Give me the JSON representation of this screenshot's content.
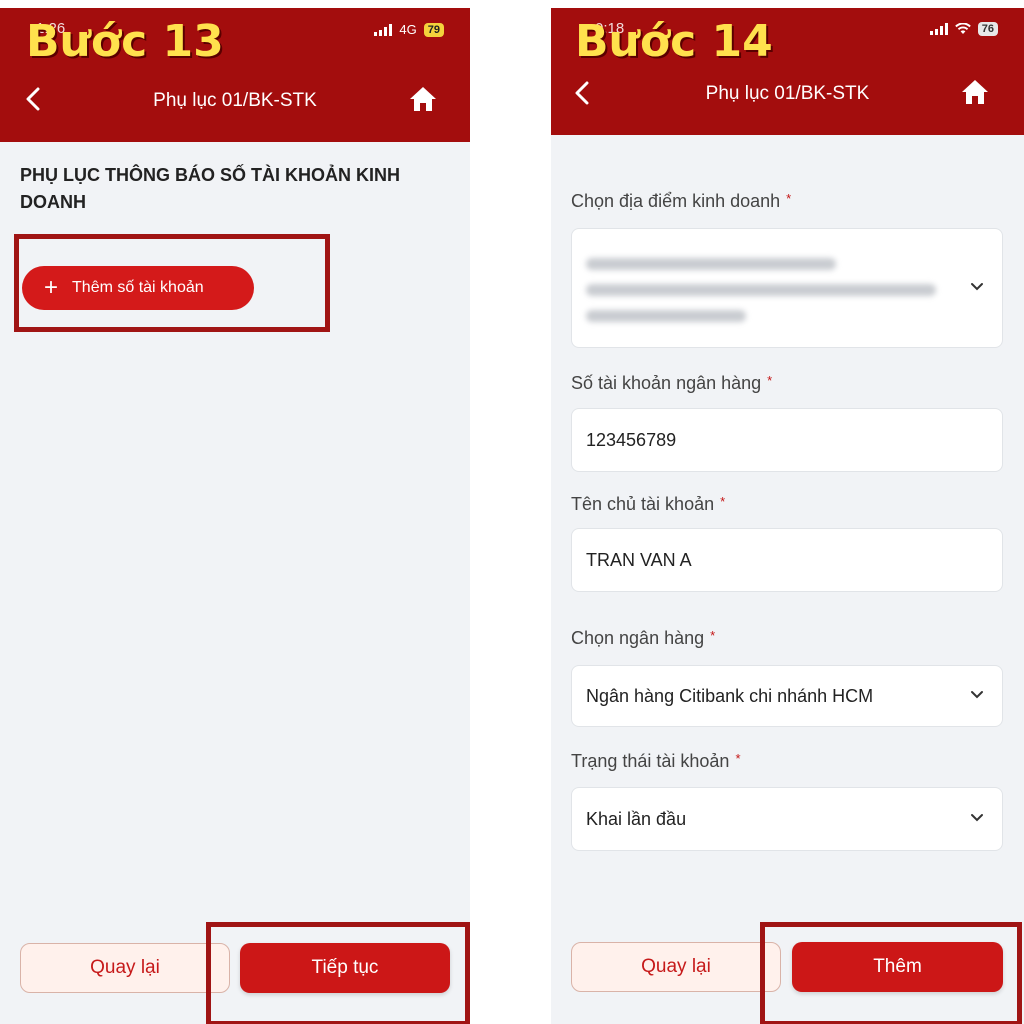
{
  "left": {
    "step_label": "Bước 13",
    "status": {
      "time": "1:26",
      "network": "4G",
      "battery": "79"
    },
    "header": {
      "title": "Phụ lục 01/BK-STK"
    },
    "section_heading": "PHỤ LỤC THÔNG BÁO SỐ TÀI KHOẢN KINH DOANH",
    "add_account_label": "Thêm số tài khoản",
    "footer": {
      "back_label": "Quay lại",
      "continue_label": "Tiếp tục"
    }
  },
  "right": {
    "step_label": "Bước 14",
    "status": {
      "time": "0:18",
      "battery": "76"
    },
    "header": {
      "title": "Phụ lục 01/BK-STK"
    },
    "form": {
      "business_location": {
        "label": "Chọn địa điểm kinh doanh",
        "required_mark": "*"
      },
      "bank_account_number": {
        "label": "Số tài khoản ngân hàng",
        "required_mark": "*",
        "value": "123456789"
      },
      "account_holder": {
        "label": "Tên chủ tài khoản",
        "required_mark": "*",
        "value": "TRAN VAN A"
      },
      "bank": {
        "label": "Chọn ngân hàng",
        "required_mark": "*",
        "value": "Ngân hàng Citibank chi nhánh HCM"
      },
      "account_status": {
        "label": "Trạng thái tài khoản",
        "required_mark": "*",
        "value": "Khai lần đầu"
      }
    },
    "footer": {
      "back_label": "Quay lại",
      "add_label": "Thêm"
    }
  },
  "colors": {
    "header_red": "#a30d0d",
    "button_red": "#cc1717",
    "step_yellow": "#ffe14d",
    "highlight": "#a01414",
    "background": "#f1f3f6"
  }
}
